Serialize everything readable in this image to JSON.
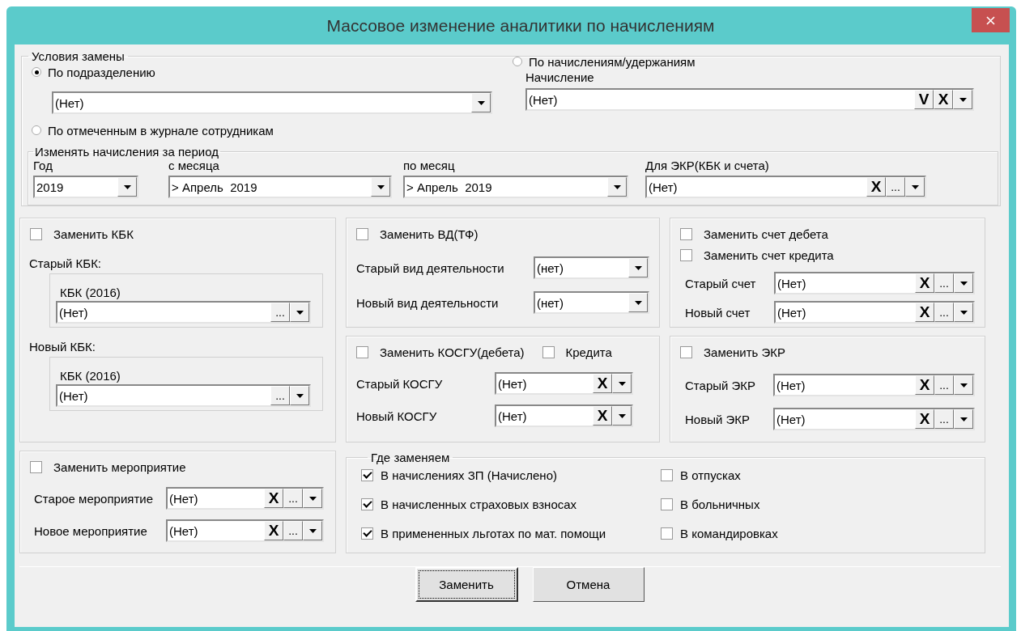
{
  "window": {
    "title": "Массовое изменение аналитики по начислениям"
  },
  "conditions": {
    "legend": "Условия замены",
    "options": [
      {
        "label": "По подразделению",
        "selected": true
      },
      {
        "label": "По отмеченным в журнале сотрудникам",
        "selected": false
      },
      {
        "label": "По начислениям/удержаниям",
        "selected": false
      }
    ],
    "department": {
      "value": "(Нет)"
    },
    "accrual": {
      "label": "Начисление",
      "value": "(Нет)",
      "buttons": [
        "V",
        "X"
      ]
    }
  },
  "period": {
    "legend": "Изменять начисления за период",
    "fields": [
      {
        "label": "Год",
        "value": "2019"
      },
      {
        "label": "с месяца",
        "value": "> Апрель  2019"
      },
      {
        "label": "по месяц",
        "value": "> Апрель  2019"
      },
      {
        "label": "Для ЭКР(КБК и счета)",
        "value": "(Нет)",
        "buttons": [
          "X",
          "..."
        ]
      }
    ]
  },
  "kbk": {
    "checkbox": {
      "label": "Заменить КБК",
      "checked": false
    },
    "groups": [
      {
        "label": "Старый КБК:",
        "field_label": "КБК (2016)",
        "value": "(Нет)",
        "buttons": [
          "..."
        ]
      },
      {
        "label": "Новый КБК:",
        "field_label": "КБК (2016)",
        "value": "(Нет)",
        "buttons": [
          "..."
        ]
      }
    ]
  },
  "activity": {
    "checkboxes": [
      {
        "label": "Заменить ВД(ТФ)",
        "checked": false
      }
    ],
    "rows": [
      {
        "label": "Старый вид деятельности",
        "value": "(нет)"
      },
      {
        "label": "Новый вид деятельности",
        "value": "(нет)"
      }
    ]
  },
  "accounts": {
    "checkboxes": [
      {
        "label": "Заменить счет дебета",
        "checked": false
      },
      {
        "label": "Заменить счет кредита",
        "checked": false
      }
    ],
    "rows": [
      {
        "label": "Старый счет",
        "value": "(Нет)",
        "buttons": [
          "X",
          "..."
        ]
      },
      {
        "label": "Новый счет",
        "value": "(Нет)",
        "buttons": [
          "X",
          "..."
        ]
      }
    ]
  },
  "kosgu": {
    "checkboxes": [
      {
        "label": "Заменить КОСГУ(дебета)",
        "checked": false
      },
      {
        "label": "Кредита",
        "checked": false
      }
    ],
    "rows": [
      {
        "label": "Старый КОСГУ",
        "value": "(Нет)",
        "buttons": [
          "X"
        ]
      },
      {
        "label": "Новый КОСГУ",
        "value": "(Нет)",
        "buttons": [
          "X"
        ]
      }
    ]
  },
  "ekr": {
    "checkboxes": [
      {
        "label": "Заменить ЭКР",
        "checked": false
      }
    ],
    "rows": [
      {
        "label": "Старый ЭКР",
        "value": "(Нет)",
        "buttons": [
          "X",
          "..."
        ]
      },
      {
        "label": "Новый ЭКР",
        "value": "(Нет)",
        "buttons": [
          "X",
          "..."
        ]
      }
    ]
  },
  "event": {
    "checkboxes": [
      {
        "label": "Заменить мероприятие",
        "checked": false
      }
    ],
    "rows": [
      {
        "label": "Старое мероприятие",
        "value": "(Нет)",
        "buttons": [
          "X",
          "..."
        ]
      },
      {
        "label": "Новое мероприятие",
        "value": "(Нет)",
        "buttons": [
          "X",
          "..."
        ]
      }
    ]
  },
  "where": {
    "legend": "Где заменяем",
    "options": [
      {
        "label": "В начислениях ЗП (Начислено)",
        "checked": true
      },
      {
        "label": "В начисленных страховых взносах",
        "checked": true
      },
      {
        "label": "В примененных льготах по мат. помощи",
        "checked": true
      },
      {
        "label": "В отпусках",
        "checked": false
      },
      {
        "label": "В больничных",
        "checked": false
      },
      {
        "label": "В  командировках",
        "checked": false
      }
    ]
  },
  "buttons": [
    {
      "label": "Заменить",
      "focused": true
    },
    {
      "label": "Отмена",
      "focused": false
    }
  ]
}
